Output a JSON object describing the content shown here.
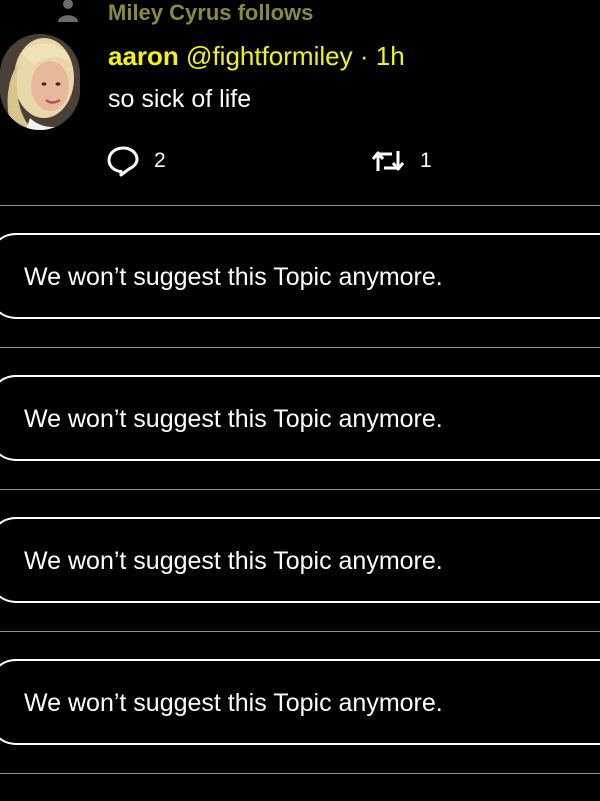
{
  "social_context": {
    "text": "Miley Cyrus follows",
    "icon": "person-icon"
  },
  "tweet": {
    "author_name": "aaron",
    "author_handle": "@fightformiley",
    "separator": "·",
    "time": "1h",
    "text": "so sick of life",
    "reply_count": "2",
    "retweet_count": "1",
    "colors": {
      "name": "#f5f500",
      "social_context": "#8a8a3a",
      "background": "#000000"
    }
  },
  "notices": [
    {
      "text": "We won’t suggest this Topic anymore."
    },
    {
      "text": "We won’t suggest this Topic anymore."
    },
    {
      "text": "We won’t suggest this Topic anymore."
    },
    {
      "text": "We won’t suggest this Topic anymore."
    }
  ]
}
